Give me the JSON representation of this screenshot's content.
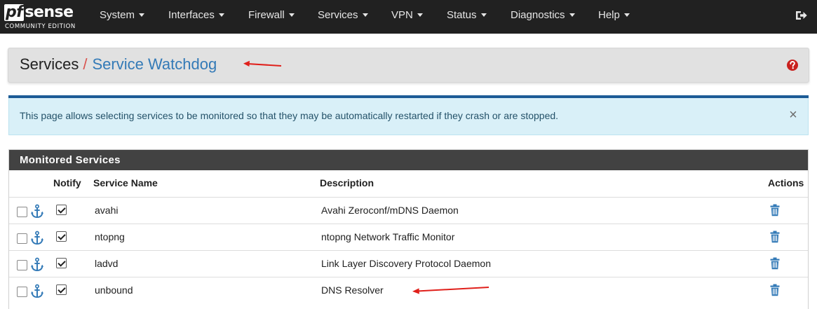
{
  "navbar": {
    "logo_brand": "sense",
    "logo_mark": "pf",
    "logo_edition": "COMMUNITY EDITION",
    "menu": [
      {
        "label": "System"
      },
      {
        "label": "Interfaces"
      },
      {
        "label": "Firewall"
      },
      {
        "label": "Services"
      },
      {
        "label": "VPN"
      },
      {
        "label": "Status"
      },
      {
        "label": "Diagnostics"
      },
      {
        "label": "Help"
      }
    ],
    "logout_icon": "sign-out-icon"
  },
  "breadcrumb": {
    "section": "Services",
    "separator": "/",
    "page": "Service Watchdog",
    "help_icon": "question-circle-icon"
  },
  "alert": {
    "text": "This page allows selecting services to be monitored so that they may be automatically restarted if they crash or are stopped.",
    "close_label": "×"
  },
  "panel": {
    "title": "Monitored Services",
    "columns": {
      "notify": "Notify",
      "service_name": "Service Name",
      "description": "Description",
      "actions": "Actions"
    },
    "rows": [
      {
        "name": "avahi",
        "description": "Avahi Zeroconf/mDNS Daemon",
        "notify": true,
        "selected": false
      },
      {
        "name": "ntopng",
        "description": "ntopng Network Traffic Monitor",
        "notify": true,
        "selected": false
      },
      {
        "name": "ladvd",
        "description": "Link Layer Discovery Protocol Daemon",
        "notify": true,
        "selected": false
      },
      {
        "name": "unbound",
        "description": "DNS Resolver",
        "notify": true,
        "selected": false
      }
    ]
  },
  "colors": {
    "navbar_bg": "#212121",
    "link": "#337ab7",
    "accent_red": "#d9534f",
    "annotation_arrow": "#e0201b",
    "help_red": "#c9211e",
    "info_bg": "#d9f0f8",
    "info_border": "#1c5b96",
    "panel_head": "#424242"
  }
}
